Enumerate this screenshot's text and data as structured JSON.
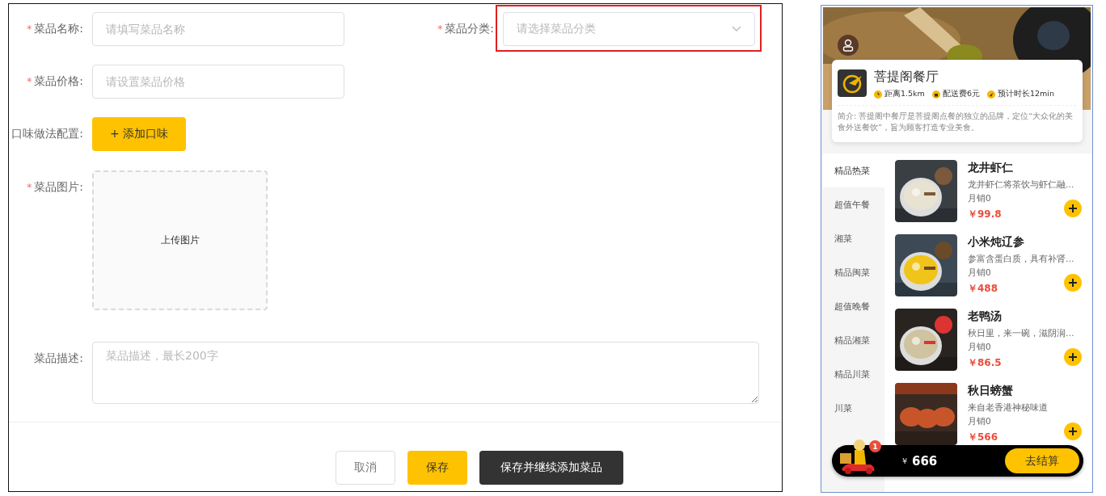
{
  "form": {
    "name": {
      "label": "菜品名称:",
      "required_mark": "*",
      "placeholder": "请填写菜品名称"
    },
    "category": {
      "label": "菜品分类:",
      "required_mark": "*",
      "placeholder": "请选择菜品分类",
      "highlighted": true
    },
    "price": {
      "label": "菜品价格:",
      "required_mark": "*",
      "placeholder": "请设置菜品价格"
    },
    "flavor": {
      "label": "口味做法配置:",
      "button": "+ 添加口味"
    },
    "image": {
      "label": "菜品图片:",
      "required_mark": "*",
      "upload": "上传图片"
    },
    "description": {
      "label": "菜品描述:",
      "placeholder": "菜品描述，最长200字"
    },
    "buttons": [
      {
        "label": "取消",
        "kind": "plain"
      },
      {
        "label": "保存",
        "kind": "primary"
      },
      {
        "label": "保存并继续添加菜品",
        "kind": "dark"
      }
    ]
  },
  "preview": {
    "shop": {
      "name": "菩提阁餐厅",
      "info": [
        "距离1.5km",
        "配送费6元",
        "预计时长12min"
      ],
      "intro": "简介: 菩提阁中餐厅是菩提阁点餐的独立的品牌，定位“大众化的美食外送餐饮”，旨为顾客打造专业美食。"
    },
    "categories": [
      {
        "label": "精品热菜",
        "selected": true
      },
      {
        "label": "超值午餐",
        "selected": false
      },
      {
        "label": "湘菜",
        "selected": false
      },
      {
        "label": "精品闽菜",
        "selected": false
      },
      {
        "label": "超值晚餐",
        "selected": false
      },
      {
        "label": "精品湘菜",
        "selected": false
      },
      {
        "label": "精品川菜",
        "selected": false
      },
      {
        "label": "川菜",
        "selected": false
      }
    ],
    "dishes": [
      {
        "name": "龙井虾仁",
        "desc": "龙井虾仁将茶饮与虾仁融…",
        "sales": "月销0",
        "price": "￥99.8"
      },
      {
        "name": "小米炖辽参",
        "desc": "参富含蛋白质，具有补肾…",
        "sales": "月销0",
        "price": "￥488"
      },
      {
        "name": "老鸭汤",
        "desc": "秋日里，来一碗，滋阴润…",
        "sales": "月销0",
        "price": "￥86.5"
      },
      {
        "name": "秋日螃蟹",
        "desc": "来自老香港神秘味道",
        "sales": "月销0",
        "price": "￥566"
      }
    ],
    "cart": {
      "badge": "1",
      "currency": "￥",
      "total": "666",
      "checkout": "去结算"
    }
  }
}
